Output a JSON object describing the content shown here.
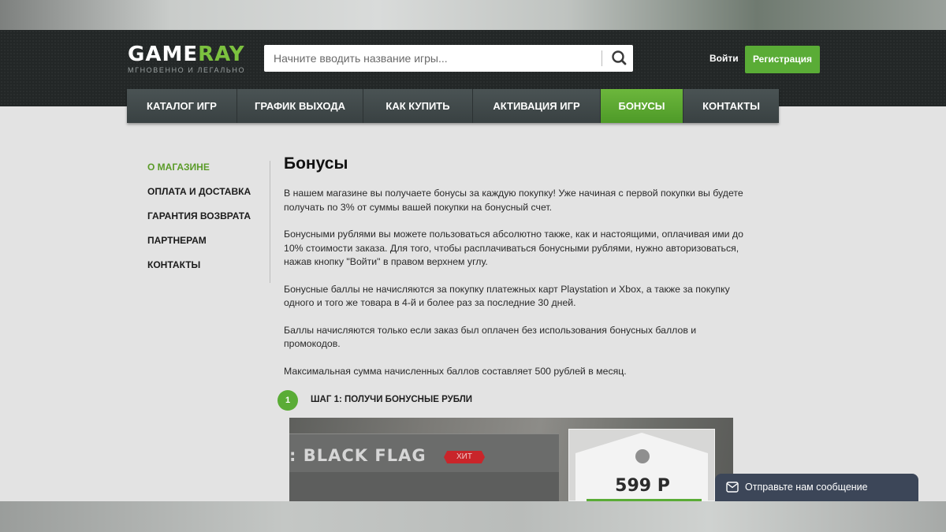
{
  "header": {
    "logo_word_1": "GAME",
    "logo_word_2": "RAY",
    "logo_tagline": "МГНОВЕННО И ЛЕГАЛЬНО",
    "search_placeholder": "Начните вводить название игры...",
    "login_label": "Войти",
    "register_label": "Регистрация"
  },
  "nav": {
    "items": [
      {
        "label": "КАТАЛОГ ИГР"
      },
      {
        "label": "ГРАФИК ВЫХОДА"
      },
      {
        "label": "КАК КУПИТЬ"
      },
      {
        "label": "АКТИВАЦИЯ ИГР"
      },
      {
        "label": "БОНУСЫ"
      },
      {
        "label": "КОНТАКТЫ"
      }
    ],
    "active_label": "БОНУСЫ"
  },
  "sidebar": {
    "items": [
      {
        "label": "О МАГАЗИНЕ"
      },
      {
        "label": "ОПЛАТА И ДОСТАВКА"
      },
      {
        "label": "ГАРАНТИЯ ВОЗВРАТА"
      },
      {
        "label": "ПАРТНЕРАМ"
      },
      {
        "label": "КОНТАКТЫ"
      }
    ],
    "active_label": "О МАГАЗИНЕ"
  },
  "content": {
    "title": "Бонусы",
    "paragraphs": [
      "В нашем магазине вы получаете бонусы за каждую покупку! Уже начиная с первой покупки вы будете получать по 3% от суммы вашей покупки на бонусный счет.",
      "Бонусными рублями вы можете пользоваться абсолютно также, как и настоящими, оплачивая ими до 10% стоимости заказа. Для того, чтобы расплачиваться бонусными рублями, нужно авторизоваться, нажав кнопку \"Войти\" в правом верхнем углу.",
      "Бонусные баллы не начисляются за покупку платежных карт Playstation и Xbox, а также за покупку одного и того же товара в 4-й и более раз за последние 30 дней.",
      "Баллы начисляются только если заказ был оплачен без использования бонусных баллов и промокодов.",
      "Максимальная сумма начисленных баллов составляет 500 рублей в месяц."
    ],
    "step": {
      "number": "1",
      "label": "ШАГ 1: ПОЛУЧИ БОНУСНЫЕ РУБЛИ"
    }
  },
  "promo": {
    "game_title": ": BLACK FLAG",
    "badge": "ХИТ",
    "price": "599 Р"
  },
  "chat": {
    "label": "Отправьте нам сообщение"
  },
  "colors": {
    "accent_green": "#5aac36",
    "nav_bg": "#3d4546",
    "header_bg": "#232727",
    "chat_bg": "#3c4658"
  },
  "icons": [
    "search-icon",
    "mail-icon",
    "tag-hole-icon"
  ]
}
